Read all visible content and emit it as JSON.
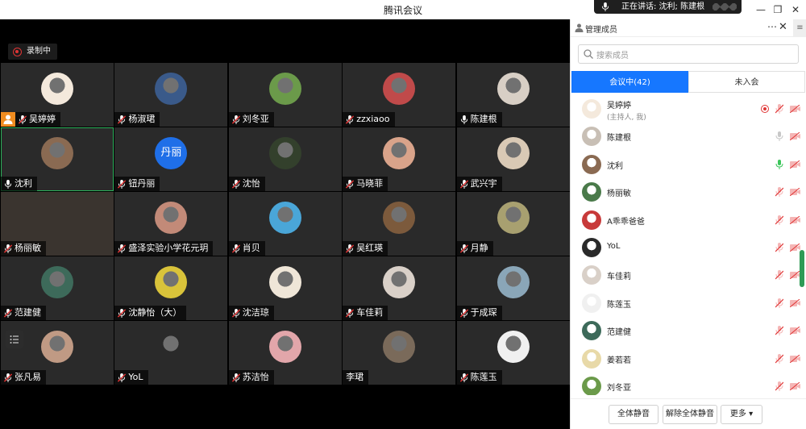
{
  "window": {
    "title": "腾讯会议"
  },
  "speaking": {
    "text": "正在讲话: 沈利; 陈建根"
  },
  "recording": {
    "label": "录制中"
  },
  "grid": [
    {
      "name": "吴婷婷",
      "muted": true,
      "host": true,
      "avatar": "#f4e9dc"
    },
    {
      "name": "杨淑珺",
      "muted": true,
      "avatar": "#3a5a8a"
    },
    {
      "name": "刘冬亚",
      "muted": true,
      "avatar": "#6b9a4a"
    },
    {
      "name": "zzxiaoo",
      "muted": true,
      "avatar": "#c04a4a"
    },
    {
      "name": "陈建根",
      "muted": false,
      "avatar": "#d8cfc5"
    },
    {
      "name": "沈利",
      "muted": false,
      "active": true,
      "avatar": "#8a6a52"
    },
    {
      "name": "钮丹丽",
      "muted": true,
      "avatar_text": "丹丽"
    },
    {
      "name": "沈怡",
      "muted": true,
      "avatar": "#33402c"
    },
    {
      "name": "马晓菲",
      "muted": true,
      "avatar": "#d9a38a"
    },
    {
      "name": "武兴宇",
      "muted": true,
      "avatar": "#d9c9b5"
    },
    {
      "name": "杨丽敏",
      "muted": true,
      "dark": true,
      "noavatar": true
    },
    {
      "name": "盛泽实验小学花元玥",
      "muted": true,
      "avatar": "#c28a78"
    },
    {
      "name": "肖贝",
      "muted": true,
      "avatar": "#4aa6d8"
    },
    {
      "name": "吴红瑛",
      "muted": true,
      "avatar": "#7c5a3c"
    },
    {
      "name": "月静",
      "muted": true,
      "avatar": "#a8a070"
    },
    {
      "name": "范建健",
      "muted": true,
      "avatar": "#3d6a5a"
    },
    {
      "name": "沈静怡（大）",
      "muted": true,
      "avatar": "#d9c33a"
    },
    {
      "name": "沈洁琼",
      "muted": true,
      "avatar": "#efe6d8"
    },
    {
      "name": "车佳莉",
      "muted": true,
      "avatar": "#d9d0c8"
    },
    {
      "name": "于成琛",
      "muted": true,
      "avatar": "#8aa6b8"
    },
    {
      "name": "张凡易",
      "muted": true,
      "avatar": "#c09a84",
      "listbtn": true
    },
    {
      "name": "YoL",
      "muted": true,
      "avatar": "#2a2a2a"
    },
    {
      "name": "苏洁怡",
      "muted": true,
      "avatar": "#e2a6aa"
    },
    {
      "name": "李珺",
      "muted": null,
      "avatar": "#7a6a5a"
    },
    {
      "name": "陈莲玉",
      "muted": true,
      "avatar": "#f0f0f0"
    }
  ],
  "panel": {
    "title": "管理成员",
    "search_placeholder": "搜索成员",
    "tab_in": "会议中(42)",
    "tab_out": "未入会",
    "members": [
      {
        "name": "吴婷婷",
        "sub": "(主持人, 我)",
        "host": true,
        "mic": "muted",
        "avatar": "#f4e9dc"
      },
      {
        "name": "陈建根",
        "mic": "on",
        "avatar": "#c8bfb5"
      },
      {
        "name": "沈利",
        "mic": "speaking",
        "avatar": "#8a6a52"
      },
      {
        "name": "杨丽敏",
        "mic": "muted",
        "avatar": "#4a7a4a"
      },
      {
        "name": "A乖乖爸爸",
        "mic": "muted",
        "avatar": "#c83a3a"
      },
      {
        "name": "YoL",
        "mic": "muted",
        "avatar": "#2a2a2a"
      },
      {
        "name": "车佳莉",
        "mic": "muted",
        "avatar": "#d9d0c8"
      },
      {
        "name": "陈莲玉",
        "mic": "muted",
        "avatar": "#f0f0f0"
      },
      {
        "name": "范建健",
        "mic": "muted",
        "avatar": "#3d6a5a"
      },
      {
        "name": "姜若若",
        "mic": "muted",
        "avatar": "#e8d9a8"
      },
      {
        "name": "刘冬亚",
        "mic": "muted",
        "avatar": "#6b9a4a"
      }
    ],
    "btn_mute_all": "全体静音",
    "btn_unmute_all": "解除全体静音",
    "btn_more": "更多"
  }
}
